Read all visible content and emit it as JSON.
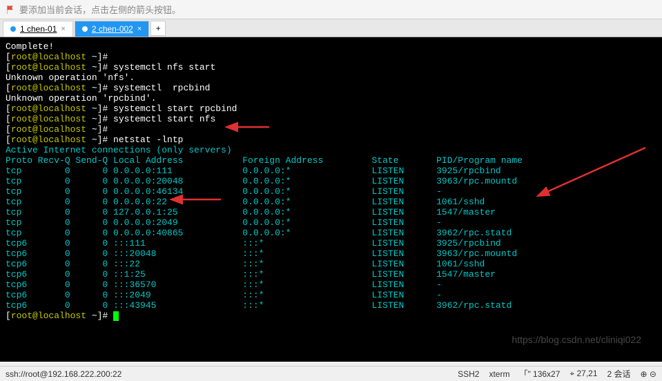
{
  "top_hint": "要添加当前会话，点击左侧的箭头按钮。",
  "tabs": [
    {
      "label": "1 chen-01"
    },
    {
      "label": "2 chen-002"
    }
  ],
  "tab_add": "+",
  "terminal": {
    "complete": "Complete!",
    "prompt_user": "root@localhost",
    "prompt_path": " ~",
    "cmd_nfs_start": "systemctl nfs start",
    "err_nfs": "Unknown operation 'nfs'.",
    "cmd_rpcbind": "systemctl  rpcbind",
    "err_rpcbind": "Unknown operation 'rpcbind'.",
    "cmd_start_rpcbind": "systemctl start rpcbind",
    "cmd_start_nfs": "systemctl start nfs",
    "cmd_netstat": "netstat -lntp",
    "netstat_title": "Active Internet connections (only servers)",
    "netstat_header": "Proto Recv-Q Send-Q Local Address           Foreign Address         State       PID/Program name",
    "rows": [
      "tcp        0      0 0.0.0.0:111             0.0.0.0:*               LISTEN      3925/rpcbind",
      "tcp        0      0 0.0.0.0:20048           0.0.0.0:*               LISTEN      3963/rpc.mountd",
      "tcp        0      0 0.0.0.0:46134           0.0.0.0:*               LISTEN      -",
      "tcp        0      0 0.0.0.0:22              0.0.0.0:*               LISTEN      1061/sshd",
      "tcp        0      0 127.0.0.1:25            0.0.0.0:*               LISTEN      1547/master",
      "tcp        0      0 0.0.0.0:2049            0.0.0.0:*               LISTEN      -",
      "tcp        0      0 0.0.0.0:40865           0.0.0.0:*               LISTEN      3962/rpc.statd",
      "tcp6       0      0 :::111                  :::*                    LISTEN      3925/rpcbind",
      "tcp6       0      0 :::20048                :::*                    LISTEN      3963/rpc.mountd",
      "tcp6       0      0 :::22                   :::*                    LISTEN      1061/sshd",
      "tcp6       0      0 ::1:25                  :::*                    LISTEN      1547/master",
      "tcp6       0      0 :::36570                :::*                    LISTEN      -",
      "tcp6       0      0 :::2049                 :::*                    LISTEN      -",
      "tcp6       0      0 :::43945                :::*                    LISTEN      3962/rpc.statd"
    ]
  },
  "status": {
    "ssh": "ssh://root@192.168.222.200:22",
    "ssh2": "SSH2",
    "xterm": "xterm",
    "size": "「\" 136x27",
    "pos": "⌖ 27,21",
    "sessions": "2 会话",
    "extra": "⊕ ⊝"
  },
  "watermark": "https://blog.csdn.net/cliniqi022"
}
